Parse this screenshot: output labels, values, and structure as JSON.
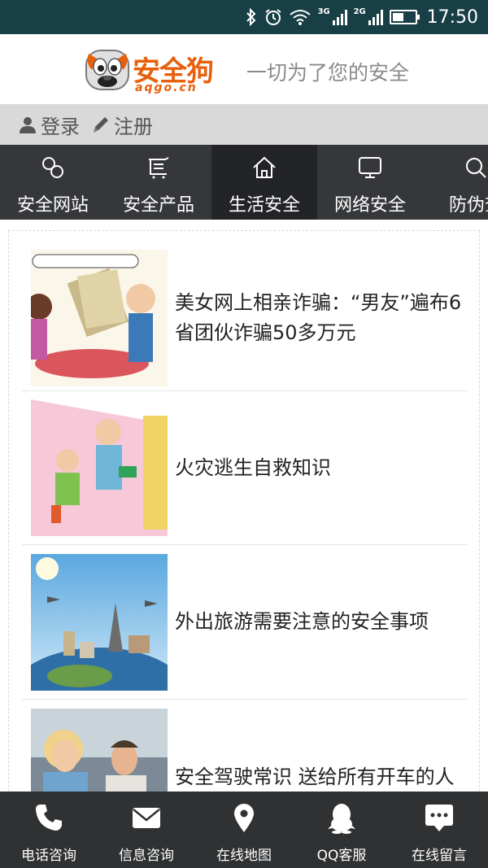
{
  "status_bar": {
    "time": "17:50",
    "network_1": "3G",
    "network_2": "2G",
    "battery_level": 0.5
  },
  "header": {
    "logo_text": "安全狗",
    "logo_subtext": "aqgo.cn",
    "slogan": "一切为了您的安全",
    "brand_color": "#e8600c"
  },
  "auth": {
    "login": "登录",
    "register": "注册"
  },
  "nav": {
    "items": [
      {
        "label": "安全网站",
        "icon": "link-icon"
      },
      {
        "label": "安全产品",
        "icon": "cart-icon"
      },
      {
        "label": "生活安全",
        "icon": "home-icon",
        "active": true
      },
      {
        "label": "网络安全",
        "icon": "monitor-icon"
      },
      {
        "label": "防伪查",
        "icon": "search-icon"
      }
    ]
  },
  "articles": [
    {
      "title": "美女网上相亲诈骗：“男友”遍布6省团伙诈骗50多万元",
      "thumb": "cartoon-dating-scam-image"
    },
    {
      "title": "火灾逃生自救知识",
      "thumb": "cartoon-fire-escape-image"
    },
    {
      "title": "外出旅游需要注意的安全事项",
      "thumb": "travel-landmarks-image"
    },
    {
      "title": "安全驾驶常识 送给所有开车的人",
      "thumb": "driving-couple-image"
    }
  ],
  "bottom_bar": {
    "items": [
      {
        "label": "电话咨询",
        "icon": "phone-icon"
      },
      {
        "label": "信息咨询",
        "icon": "mail-icon"
      },
      {
        "label": "在线地图",
        "icon": "map-pin-icon"
      },
      {
        "label": "QQ客服",
        "icon": "qq-icon"
      },
      {
        "label": "在线留言",
        "icon": "chat-icon"
      }
    ]
  }
}
